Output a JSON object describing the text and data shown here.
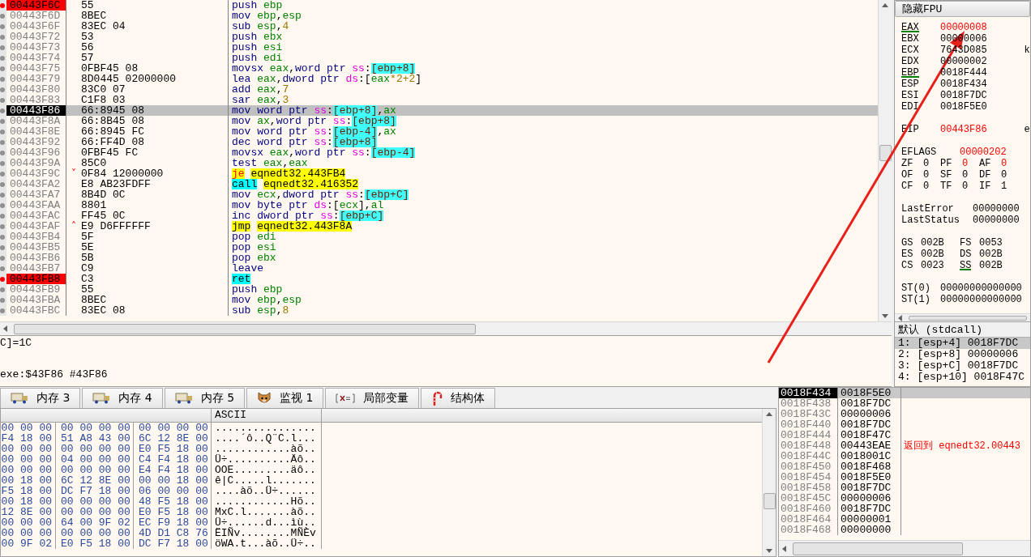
{
  "disassembly": {
    "rows": [
      {
        "address": "00443F6C",
        "bytes": "55",
        "breakpoint": true,
        "current": false,
        "instruction": [
          {
            "text": "push ",
            "kind": "op"
          },
          {
            "text": "ebp",
            "kind": "reg"
          }
        ]
      },
      {
        "address": "00443F6D",
        "bytes": "8BEC",
        "breakpoint": false,
        "current": false,
        "instruction": [
          {
            "text": "mov ",
            "kind": "op"
          },
          {
            "text": "ebp",
            "kind": "reg"
          },
          {
            "text": ",",
            "kind": "p"
          },
          {
            "text": "esp",
            "kind": "reg"
          }
        ]
      },
      {
        "address": "00443F6F",
        "bytes": "83EC 04",
        "breakpoint": false,
        "current": false,
        "instruction": [
          {
            "text": "sub ",
            "kind": "op"
          },
          {
            "text": "esp",
            "kind": "reg"
          },
          {
            "text": ",",
            "kind": "p"
          },
          {
            "text": "4",
            "kind": "num"
          }
        ]
      },
      {
        "address": "00443F72",
        "bytes": "53",
        "breakpoint": false,
        "current": false,
        "instruction": [
          {
            "text": "push ",
            "kind": "op"
          },
          {
            "text": "ebx",
            "kind": "reg"
          }
        ]
      },
      {
        "address": "00443F73",
        "bytes": "56",
        "breakpoint": false,
        "current": false,
        "instruction": [
          {
            "text": "push ",
            "kind": "op"
          },
          {
            "text": "esi",
            "kind": "reg"
          }
        ]
      },
      {
        "address": "00443F74",
        "bytes": "57",
        "breakpoint": false,
        "current": false,
        "instruction": [
          {
            "text": "push ",
            "kind": "op"
          },
          {
            "text": "edi",
            "kind": "reg"
          }
        ]
      },
      {
        "address": "00443F75",
        "bytes": "0FBF45 08",
        "breakpoint": false,
        "current": false,
        "instruction": [
          {
            "text": "movsx ",
            "kind": "op"
          },
          {
            "text": "eax",
            "kind": "reg"
          },
          {
            "text": ",",
            "kind": "p"
          },
          {
            "text": "word ptr ",
            "kind": "kw"
          },
          {
            "text": "ss",
            "kind": "seg"
          },
          {
            "text": ":",
            "kind": "p"
          },
          {
            "text": "[ebp+8]",
            "kind": "mem"
          }
        ]
      },
      {
        "address": "00443F79",
        "bytes": "8D0445 02000000",
        "breakpoint": false,
        "current": false,
        "instruction": [
          {
            "text": "lea ",
            "kind": "op"
          },
          {
            "text": "eax",
            "kind": "reg"
          },
          {
            "text": ",",
            "kind": "p"
          },
          {
            "text": "dword ptr ",
            "kind": "kw"
          },
          {
            "text": "ds",
            "kind": "seg"
          },
          {
            "text": ":[",
            "kind": "p"
          },
          {
            "text": "eax",
            "kind": "reg"
          },
          {
            "text": "*2+2",
            "kind": "num"
          },
          {
            "text": "]",
            "kind": "p"
          }
        ]
      },
      {
        "address": "00443F80",
        "bytes": "83C0 07",
        "breakpoint": false,
        "current": false,
        "instruction": [
          {
            "text": "add ",
            "kind": "op"
          },
          {
            "text": "eax",
            "kind": "reg"
          },
          {
            "text": ",",
            "kind": "p"
          },
          {
            "text": "7",
            "kind": "num"
          }
        ]
      },
      {
        "address": "00443F83",
        "bytes": "C1F8 03",
        "breakpoint": false,
        "current": false,
        "instruction": [
          {
            "text": "sar ",
            "kind": "op"
          },
          {
            "text": "eax",
            "kind": "reg"
          },
          {
            "text": ",",
            "kind": "p"
          },
          {
            "text": "3",
            "kind": "num"
          }
        ]
      },
      {
        "address": "00443F86",
        "bytes": "66:8945 08",
        "breakpoint": false,
        "current": true,
        "instruction": [
          {
            "text": "mov ",
            "kind": "op"
          },
          {
            "text": "word ptr ",
            "kind": "kw"
          },
          {
            "text": "ss",
            "kind": "seg"
          },
          {
            "text": ":",
            "kind": "p"
          },
          {
            "text": "[ebp+8]",
            "kind": "mem"
          },
          {
            "text": ",",
            "kind": "p"
          },
          {
            "text": "ax",
            "kind": "reg"
          }
        ]
      },
      {
        "address": "00443F8A",
        "bytes": "66:8B45 08",
        "breakpoint": false,
        "current": false,
        "instruction": [
          {
            "text": "mov ",
            "kind": "op"
          },
          {
            "text": "ax",
            "kind": "reg"
          },
          {
            "text": ",",
            "kind": "p"
          },
          {
            "text": "word ptr ",
            "kind": "kw"
          },
          {
            "text": "ss",
            "kind": "seg"
          },
          {
            "text": ":",
            "kind": "p"
          },
          {
            "text": "[ebp+8]",
            "kind": "mem"
          }
        ]
      },
      {
        "address": "00443F8E",
        "bytes": "66:8945 FC",
        "breakpoint": false,
        "current": false,
        "instruction": [
          {
            "text": "mov ",
            "kind": "op"
          },
          {
            "text": "word ptr ",
            "kind": "kw"
          },
          {
            "text": "ss",
            "kind": "seg"
          },
          {
            "text": ":",
            "kind": "p"
          },
          {
            "text": "[ebp-4]",
            "kind": "mem"
          },
          {
            "text": ",",
            "kind": "p"
          },
          {
            "text": "ax",
            "kind": "reg"
          }
        ]
      },
      {
        "address": "00443F92",
        "bytes": "66:FF4D 08",
        "breakpoint": false,
        "current": false,
        "instruction": [
          {
            "text": "dec ",
            "kind": "op"
          },
          {
            "text": "word ptr ",
            "kind": "kw"
          },
          {
            "text": "ss",
            "kind": "seg"
          },
          {
            "text": ":",
            "kind": "p"
          },
          {
            "text": "[ebp+8]",
            "kind": "mem"
          }
        ]
      },
      {
        "address": "00443F96",
        "bytes": "0FBF45 FC",
        "breakpoint": false,
        "current": false,
        "instruction": [
          {
            "text": "movsx ",
            "kind": "op"
          },
          {
            "text": "eax",
            "kind": "reg"
          },
          {
            "text": ",",
            "kind": "p"
          },
          {
            "text": "word ptr ",
            "kind": "kw"
          },
          {
            "text": "ss",
            "kind": "seg"
          },
          {
            "text": ":",
            "kind": "p"
          },
          {
            "text": "[ebp-4]",
            "kind": "mem"
          }
        ]
      },
      {
        "address": "00443F9A",
        "bytes": "85C0",
        "breakpoint": false,
        "current": false,
        "instruction": [
          {
            "text": "test ",
            "kind": "op"
          },
          {
            "text": "eax",
            "kind": "reg"
          },
          {
            "text": ",",
            "kind": "p"
          },
          {
            "text": "eax",
            "kind": "reg"
          }
        ]
      },
      {
        "address": "00443F9C",
        "bytes": "0F84 12000000",
        "breakpoint": false,
        "current": false,
        "branch_mark": "˅",
        "instruction": [
          {
            "text": "je",
            "kind": "jcc"
          },
          {
            "text": "eqnedt32.443FB4",
            "kind": "tgt"
          }
        ]
      },
      {
        "address": "00443FA2",
        "bytes": "E8 AB23FDFF",
        "breakpoint": false,
        "current": false,
        "instruction": [
          {
            "text": "call",
            "kind": "call"
          },
          {
            "text": "eqnedt32.416352",
            "kind": "tgt"
          }
        ]
      },
      {
        "address": "00443FA7",
        "bytes": "8B4D 0C",
        "breakpoint": false,
        "current": false,
        "instruction": [
          {
            "text": "mov ",
            "kind": "op"
          },
          {
            "text": "ecx",
            "kind": "reg"
          },
          {
            "text": ",",
            "kind": "p"
          },
          {
            "text": "dword ptr ",
            "kind": "kw"
          },
          {
            "text": "ss",
            "kind": "seg"
          },
          {
            "text": ":",
            "kind": "p"
          },
          {
            "text": "[ebp+C]",
            "kind": "mem"
          }
        ]
      },
      {
        "address": "00443FAA",
        "bytes": "8801",
        "breakpoint": false,
        "current": false,
        "instruction": [
          {
            "text": "mov ",
            "kind": "op"
          },
          {
            "text": "byte ptr ",
            "kind": "kw"
          },
          {
            "text": "ds",
            "kind": "seg"
          },
          {
            "text": ":[",
            "kind": "p"
          },
          {
            "text": "ecx",
            "kind": "reg"
          },
          {
            "text": "],",
            "kind": "p"
          },
          {
            "text": "al",
            "kind": "reg"
          }
        ]
      },
      {
        "address": "00443FAC",
        "bytes": "FF45 0C",
        "breakpoint": false,
        "current": false,
        "instruction": [
          {
            "text": "inc ",
            "kind": "op"
          },
          {
            "text": "dword ptr ",
            "kind": "kw"
          },
          {
            "text": "ss",
            "kind": "seg"
          },
          {
            "text": ":",
            "kind": "p"
          },
          {
            "text": "[ebp+C]",
            "kind": "mem"
          }
        ]
      },
      {
        "address": "00443FAF",
        "bytes": "E9 D6FFFFFF",
        "breakpoint": false,
        "current": false,
        "branch_mark": "˄",
        "instruction": [
          {
            "text": "jmp",
            "kind": "jmp"
          },
          {
            "text": "eqnedt32.443F8A",
            "kind": "tgt"
          }
        ]
      },
      {
        "address": "00443FB4",
        "bytes": "5F",
        "breakpoint": false,
        "current": false,
        "instruction": [
          {
            "text": "pop ",
            "kind": "op"
          },
          {
            "text": "edi",
            "kind": "reg"
          }
        ]
      },
      {
        "address": "00443FB5",
        "bytes": "5E",
        "breakpoint": false,
        "current": false,
        "instruction": [
          {
            "text": "pop ",
            "kind": "op"
          },
          {
            "text": "esi",
            "kind": "reg"
          }
        ]
      },
      {
        "address": "00443FB6",
        "bytes": "5B",
        "breakpoint": false,
        "current": false,
        "instruction": [
          {
            "text": "pop ",
            "kind": "op"
          },
          {
            "text": "ebx",
            "kind": "reg"
          }
        ]
      },
      {
        "address": "00443FB7",
        "bytes": "C9",
        "breakpoint": false,
        "current": false,
        "instruction": [
          {
            "text": "leave",
            "kind": "op"
          }
        ]
      },
      {
        "address": "00443FB8",
        "bytes": "C3",
        "breakpoint": true,
        "current": false,
        "instruction": [
          {
            "text": "ret",
            "kind": "ret"
          }
        ]
      },
      {
        "address": "00443FB9",
        "bytes": "55",
        "breakpoint": false,
        "current": false,
        "instruction": [
          {
            "text": "push ",
            "kind": "op"
          },
          {
            "text": "ebp",
            "kind": "reg"
          }
        ]
      },
      {
        "address": "00443FBA",
        "bytes": "8BEC",
        "breakpoint": false,
        "current": false,
        "instruction": [
          {
            "text": "mov ",
            "kind": "op"
          },
          {
            "text": "ebp",
            "kind": "reg"
          },
          {
            "text": ",",
            "kind": "p"
          },
          {
            "text": "esp",
            "kind": "reg"
          }
        ]
      },
      {
        "address": "00443FBC",
        "bytes": "83EC 08",
        "breakpoint": false,
        "current": false,
        "instruction": [
          {
            "text": "sub ",
            "kind": "op"
          },
          {
            "text": "esp",
            "kind": "reg"
          },
          {
            "text": ",",
            "kind": "p"
          },
          {
            "text": "8",
            "kind": "num"
          }
        ]
      }
    ]
  },
  "info": {
    "lines": [
      "C]=1C",
      "exe:$43F86 #43F86"
    ]
  },
  "registers": {
    "header": "隐藏FPU",
    "groups": [
      {
        "kind": "gpr",
        "rows": [
          {
            "cells": [
              {
                "name": "EAX",
                "value": "00000008",
                "changed": true,
                "highlighted": true
              }
            ]
          },
          {
            "cells": [
              {
                "name": "EBX",
                "value": "00000006",
                "changed": false,
                "highlighted": false
              }
            ]
          },
          {
            "cells": [
              {
                "name": "ECX",
                "value": "7643D085",
                "changed": false,
                "highlighted": false
              }
            ],
            "comment": "k"
          },
          {
            "cells": [
              {
                "name": "EDX",
                "value": "00000002",
                "changed": false,
                "highlighted": false
              }
            ]
          },
          {
            "cells": [
              {
                "name": "EBP",
                "value": "0018F444",
                "changed": false,
                "highlighted": true
              }
            ]
          },
          {
            "cells": [
              {
                "name": "ESP",
                "value": "0018F434",
                "changed": false,
                "highlighted": false
              }
            ]
          },
          {
            "cells": [
              {
                "name": "ESI",
                "value": "0018F7DC",
                "changed": false,
                "highlighted": false
              }
            ]
          },
          {
            "cells": [
              {
                "name": "EDI",
                "value": "0018F5E0",
                "changed": false,
                "highlighted": false
              }
            ]
          }
        ]
      },
      {
        "kind": "gpr",
        "rows": [
          {
            "cells": [
              {
                "name": "EIP",
                "value": "00443F86",
                "changed": true,
                "highlighted": false
              }
            ],
            "comment": "e"
          }
        ]
      },
      {
        "kind": "flags",
        "rows": [
          {
            "cells": [
              {
                "name": "EFLAGS",
                "value": "00000202",
                "changed": true,
                "highlighted": false
              }
            ]
          },
          {
            "cells": [
              {
                "name": "ZF",
                "value": "0",
                "changed": false,
                "highlighted": false
              },
              {
                "name": "PF",
                "value": "0",
                "changed": true,
                "highlighted": false
              },
              {
                "name": "AF",
                "value": "0",
                "changed": true,
                "highlighted": false
              }
            ]
          },
          {
            "cells": [
              {
                "name": "OF",
                "value": "0",
                "changed": false,
                "highlighted": false
              },
              {
                "name": "SF",
                "value": "0",
                "changed": false,
                "highlighted": false
              },
              {
                "name": "DF",
                "value": "0",
                "changed": false,
                "highlighted": false
              }
            ]
          },
          {
            "cells": [
              {
                "name": "CF",
                "value": "0",
                "changed": false,
                "highlighted": false
              },
              {
                "name": "TF",
                "value": "0",
                "changed": false,
                "highlighted": false
              },
              {
                "name": "IF",
                "value": "1",
                "changed": false,
                "highlighted": false
              }
            ]
          }
        ]
      },
      {
        "kind": "status",
        "rows": [
          {
            "cells": [
              {
                "name": "LastError",
                "value": "00000000",
                "changed": false,
                "highlighted": false
              }
            ]
          },
          {
            "cells": [
              {
                "name": "LastStatus",
                "value": "00000000",
                "changed": false,
                "highlighted": false
              }
            ]
          }
        ]
      },
      {
        "kind": "segments",
        "rows": [
          {
            "cells": [
              {
                "name": "GS",
                "value": "002B",
                "changed": false,
                "highlighted": false
              },
              {
                "name": "FS",
                "value": "0053",
                "changed": false,
                "highlighted": false
              }
            ]
          },
          {
            "cells": [
              {
                "name": "ES",
                "value": "002B",
                "changed": false,
                "highlighted": false
              },
              {
                "name": "DS",
                "value": "002B",
                "changed": false,
                "highlighted": false
              }
            ]
          },
          {
            "cells": [
              {
                "name": "CS",
                "value": "0023",
                "changed": false,
                "highlighted": false
              },
              {
                "name": "SS",
                "value": "002B",
                "changed": false,
                "highlighted": true
              }
            ]
          }
        ]
      },
      {
        "kind": "fpu",
        "rows": [
          {
            "cells": [
              {
                "name": "ST(0)",
                "value": "00000000000000",
                "changed": false,
                "highlighted": false
              }
            ]
          },
          {
            "cells": [
              {
                "name": "ST(1)",
                "value": "00000000000000",
                "changed": false,
                "highlighted": false
              }
            ]
          }
        ]
      }
    ]
  },
  "call_stack": {
    "header": "默认 (stdcall)",
    "rows": [
      {
        "text": "1: [esp+4] 0018F7DC",
        "selected": true
      },
      {
        "text": "2: [esp+8] 00000006",
        "selected": false
      },
      {
        "text": "3: [esp+C] 0018F7DC",
        "selected": false
      },
      {
        "text": "4: [esp+10] 0018F47C",
        "selected": false
      }
    ]
  },
  "tabs": [
    {
      "label": "内存 3",
      "kind": "memory"
    },
    {
      "label": "内存 4",
      "kind": "memory"
    },
    {
      "label": "内存 5",
      "kind": "memory"
    },
    {
      "label": "监视 1",
      "kind": "watch"
    },
    {
      "label": "局部变量",
      "kind": "locals"
    },
    {
      "label": "结构体",
      "kind": "struct"
    }
  ],
  "dump": {
    "ascii_header": "ASCII",
    "rows": [
      {
        "groups": [
          "00 00 00",
          "00 00 00 00",
          "00 00 00 00"
        ],
        "ascii": "................"
      },
      {
        "groups": [
          "F4 18 00",
          "51 A8 43 00",
          "6C 12 8E 00"
        ],
        "ascii": "....´ô..Q¨C.l..."
      },
      {
        "groups": [
          "00 00 00",
          "00 00 00 00",
          "E0 F5 18 00"
        ],
        "ascii": "............àõ.."
      },
      {
        "groups": [
          "00 00 00",
          "04 00 00 00",
          "C4 F4 18 00"
        ],
        "ascii": "Ü÷..........Äô.."
      },
      {
        "groups": [
          "00 00 00",
          "00 00 00 00",
          "E4 F4 18 00"
        ],
        "ascii": "OOE.........äô.."
      },
      {
        "groups": [
          "00 18 00",
          "6C 12 8E 00",
          "00 00 18 00"
        ],
        "ascii": "ê|C.....l......."
      },
      {
        "groups": [
          "F5 18 00",
          "DC F7 18 00",
          "06 00 00 00"
        ],
        "ascii": "....àõ..Ü÷......"
      },
      {
        "groups": [
          "00 18 00",
          "00 00 00 00",
          "48 F5 18 00"
        ],
        "ascii": "............Hõ.."
      },
      {
        "groups": [
          "12 8E 00",
          "00 00 00 00",
          "E0 F5 18 00"
        ],
        "ascii": "MxC.l.......àõ.."
      },
      {
        "groups": [
          "00 00 00",
          "64 00 9F 02",
          "EC F9 18 00"
        ],
        "ascii": "Ü÷......d...ìù.."
      },
      {
        "groups": [
          "00 00 00",
          "00 00 00 00",
          "4D D1 C8 76"
        ],
        "ascii": "ËIÑv........MÑÈv"
      },
      {
        "groups": [
          "00 9F 02",
          "E0 F5 18 00",
          "DC F7 18 00"
        ],
        "ascii": "öWA.t...àõ..Ü÷.."
      }
    ]
  },
  "stack": {
    "rows": [
      {
        "address": "0018F434",
        "value": "0018F5E0",
        "selected": true
      },
      {
        "address": "0018F438",
        "value": "0018F7DC",
        "selected": false
      },
      {
        "address": "0018F43C",
        "value": "00000006",
        "selected": false
      },
      {
        "address": "0018F440",
        "value": "0018F7DC",
        "selected": false
      },
      {
        "address": "0018F444",
        "value": "0018F47C",
        "selected": false
      },
      {
        "address": "0018F448",
        "value": "00443EAE",
        "selected": false,
        "comment": "返回到 eqnedt32.00443"
      },
      {
        "address": "0018F44C",
        "value": "0018001C",
        "selected": false
      },
      {
        "address": "0018F450",
        "value": "0018F468",
        "selected": false
      },
      {
        "address": "0018F454",
        "value": "0018F5E0",
        "selected": false
      },
      {
        "address": "0018F458",
        "value": "0018F7DC",
        "selected": false
      },
      {
        "address": "0018F45C",
        "value": "00000006",
        "selected": false
      },
      {
        "address": "0018F460",
        "value": "0018F7DC",
        "selected": false
      },
      {
        "address": "0018F464",
        "value": "00000001",
        "selected": false
      },
      {
        "address": "0018F468",
        "value": "00000000",
        "selected": false
      }
    ]
  }
}
